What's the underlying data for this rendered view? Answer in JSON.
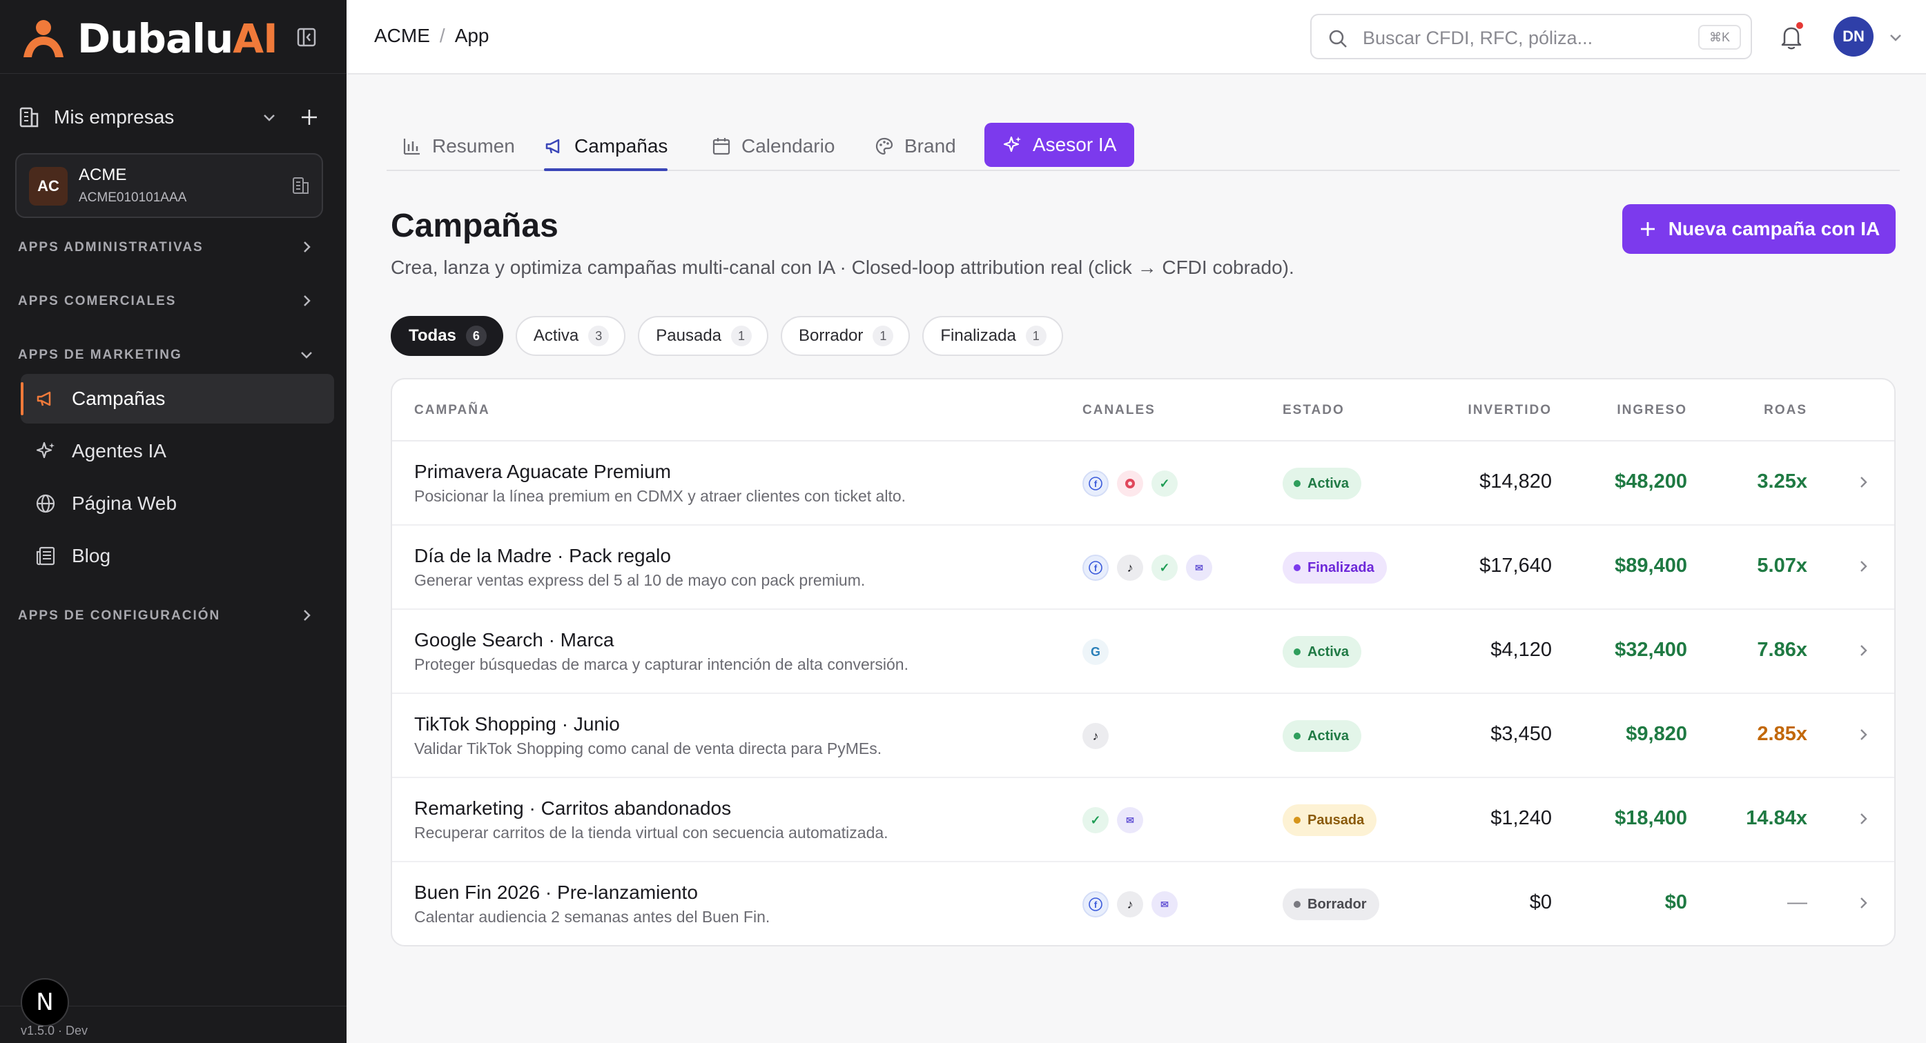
{
  "brand": {
    "name_main": "Dubalu",
    "name_accent": "AI"
  },
  "sidebar": {
    "company_selector_label": "Mis empresas",
    "company": {
      "initials": "AC",
      "name": "ACME",
      "rfc": "ACME010101AAA"
    },
    "sections": {
      "admin": "APPS ADMINISTRATIVAS",
      "comercial": "APPS COMERCIALES",
      "marketing": "APPS DE MARKETING",
      "config": "APPS DE CONFIGURACIÓN"
    },
    "marketing_items": [
      {
        "label": "Campañas",
        "icon": "megaphone-icon"
      },
      {
        "label": "Agentes IA",
        "icon": "sparkles-icon"
      },
      {
        "label": "Página Web",
        "icon": "globe-icon"
      },
      {
        "label": "Blog",
        "icon": "newspaper-icon"
      }
    ],
    "footer_badge": "N",
    "version": "v1.5.0 · Dev"
  },
  "topbar": {
    "breadcrumb": [
      "ACME",
      "App"
    ],
    "breadcrumb_sep": "/",
    "search_placeholder": "Buscar CFDI, RFC, póliza...",
    "search_shortcut": "⌘K",
    "user_initials": "DN"
  },
  "tabs": [
    {
      "label": "Resumen",
      "icon": "bar-chart-icon"
    },
    {
      "label": "Campañas",
      "icon": "megaphone-icon"
    },
    {
      "label": "Calendario",
      "icon": "calendar-icon"
    },
    {
      "label": "Brand",
      "icon": "palette-icon"
    },
    {
      "label": "Asesor IA",
      "icon": "sparkles-icon"
    }
  ],
  "page": {
    "title": "Campañas",
    "subtitle": "Crea, lanza y optimiza campañas multi-canal con IA · Closed-loop attribution real (click → CFDI cobrado).",
    "new_button": "Nueva campaña con IA"
  },
  "filters": [
    {
      "label": "Todas",
      "count": "6"
    },
    {
      "label": "Activa",
      "count": "3"
    },
    {
      "label": "Pausada",
      "count": "1"
    },
    {
      "label": "Borrador",
      "count": "1"
    },
    {
      "label": "Finalizada",
      "count": "1"
    }
  ],
  "table": {
    "headers": {
      "campaign": "CAMPAÑA",
      "channels": "CANALES",
      "status": "ESTADO",
      "invested": "INVERTIDO",
      "revenue": "INGRESO",
      "roas": "ROAS"
    },
    "rows": [
      {
        "name": "Primavera Aguacate Premium",
        "desc": "Posicionar la línea premium en CDMX y atraer clientes con ticket alto.",
        "channels": [
          "facebook",
          "instagram",
          "whatsapp"
        ],
        "status": "Activa",
        "invested": "$14,820",
        "revenue": "$48,200",
        "roas": "3.25x"
      },
      {
        "name": "Día de la Madre · Pack regalo",
        "desc": "Generar ventas express del 5 al 10 de mayo con pack premium.",
        "channels": [
          "facebook",
          "tiktok",
          "whatsapp",
          "email"
        ],
        "status": "Finalizada",
        "invested": "$17,640",
        "revenue": "$89,400",
        "roas": "5.07x"
      },
      {
        "name": "Google Search · Marca",
        "desc": "Proteger búsquedas de marca y capturar intención de alta conversión.",
        "channels": [
          "google"
        ],
        "status": "Activa",
        "invested": "$4,120",
        "revenue": "$32,400",
        "roas": "7.86x"
      },
      {
        "name": "TikTok Shopping · Junio",
        "desc": "Validar TikTok Shopping como canal de venta directa para PyMEs.",
        "channels": [
          "tiktok"
        ],
        "status": "Activa",
        "invested": "$3,450",
        "revenue": "$9,820",
        "roas": "2.85x"
      },
      {
        "name": "Remarketing · Carritos abandonados",
        "desc": "Recuperar carritos de la tienda virtual con secuencia automatizada.",
        "channels": [
          "whatsapp",
          "email"
        ],
        "status": "Pausada",
        "invested": "$1,240",
        "revenue": "$18,400",
        "roas": "14.84x"
      },
      {
        "name": "Buen Fin 2026 · Pre-lanzamiento",
        "desc": "Calentar audiencia 2 semanas antes del Buen Fin.",
        "channels": [
          "facebook",
          "tiktok",
          "email"
        ],
        "status": "Borrador",
        "invested": "$0",
        "revenue": "$0",
        "roas": "—"
      }
    ]
  },
  "colors": {
    "accent": "#7c3aed",
    "brand_orange": "#f07a3a",
    "sidebar_bg": "#1b1b1d",
    "positive": "#1f7a43",
    "warning": "#c2680a"
  }
}
